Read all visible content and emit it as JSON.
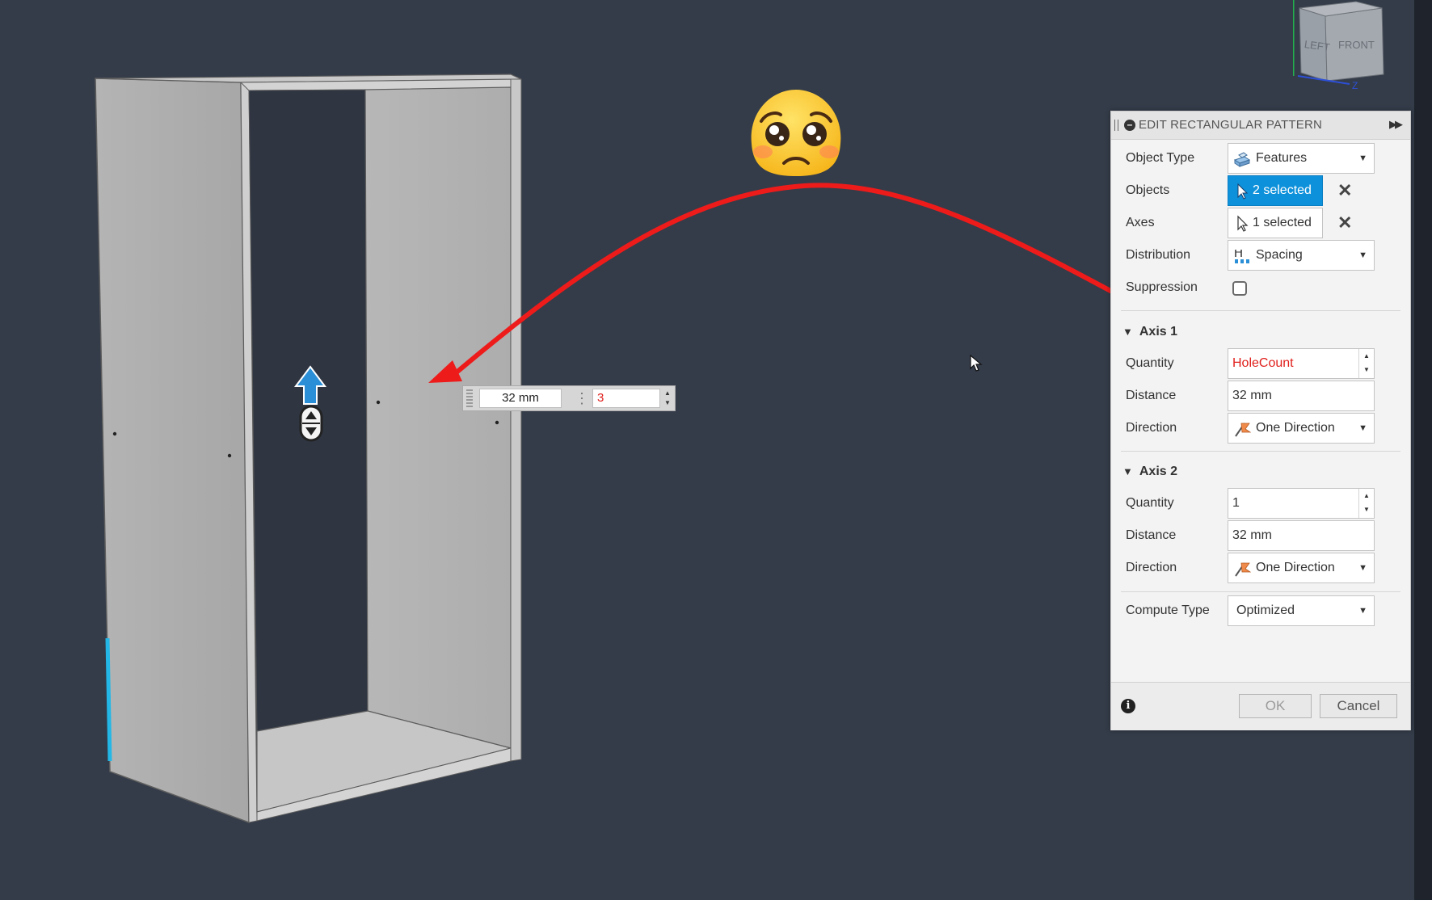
{
  "panel": {
    "title": "EDIT RECTANGULAR PATTERN",
    "object_type": {
      "label": "Object Type",
      "value": "Features"
    },
    "objects": {
      "label": "Objects",
      "value": "2 selected"
    },
    "axes": {
      "label": "Axes",
      "value": "1 selected"
    },
    "distribution": {
      "label": "Distribution",
      "value": "Spacing"
    },
    "suppression": {
      "label": "Suppression",
      "checked": false
    },
    "axis1": {
      "title": "Axis 1",
      "quantity_label": "Quantity",
      "quantity": "HoleCount",
      "distance_label": "Distance",
      "distance": "32 mm",
      "direction_label": "Direction",
      "direction": "One Direction"
    },
    "axis2": {
      "title": "Axis 2",
      "quantity_label": "Quantity",
      "quantity": "1",
      "distance_label": "Distance",
      "distance": "32 mm",
      "direction_label": "Direction",
      "direction": "One Direction"
    },
    "compute_type": {
      "label": "Compute Type",
      "value": "Optimized"
    },
    "ok_label": "OK",
    "cancel_label": "Cancel"
  },
  "canvas_input": {
    "distance": "32 mm",
    "quantity": "3"
  },
  "viewcube": {
    "left_face": "LEFT",
    "front_face": "FRONT",
    "axis_label": "Z"
  },
  "colors": {
    "viewport_bg": "#343c49",
    "accent_blue": "#0e91db",
    "annotation_red": "#ee1b1b",
    "expression_red": "#e0201c"
  },
  "icons": [
    "pleading-face-emoji",
    "mouse-cursor-icon",
    "move-arrow-icon",
    "pointer-select-icon",
    "features-icon",
    "spacing-icon",
    "direction-flag-icon",
    "info-icon"
  ]
}
